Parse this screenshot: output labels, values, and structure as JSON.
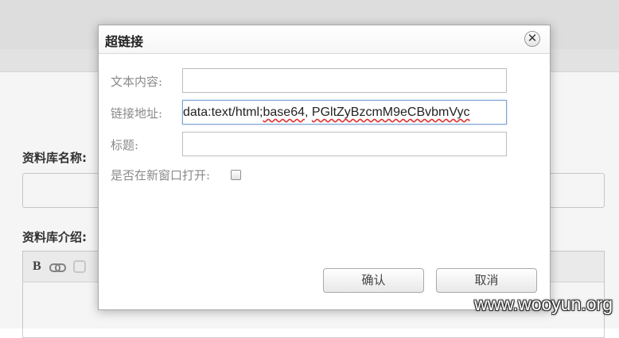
{
  "background_page": {
    "name_label": "资料库名称:",
    "intro_label": "资料库介绍:",
    "editor_toolbar": {
      "bold_label": "B",
      "icons": [
        "link-icon",
        "unlink-icon"
      ]
    }
  },
  "dialog": {
    "title": "超链接",
    "close_label": "✕",
    "fields": {
      "text_label": "文本内容:",
      "text_value": "",
      "url_label": "链接地址:",
      "url_value": {
        "prefix": "data:text/html;",
        "squiggle1": "base64",
        "mid": ", ",
        "squiggle2": "PGltZyBzcmM9eCBvbmVyc"
      },
      "title_label": "标题:",
      "title_value": "",
      "new_window_label": "是否在新窗口打开:",
      "new_window_checked": false
    },
    "buttons": {
      "ok": "确认",
      "cancel": "取消"
    }
  },
  "watermark": "www.wooyun.org",
  "colors": {
    "focus_border": "#7aa2d6",
    "label_gray": "#8a8a8a",
    "spell_underline": "#e03030"
  }
}
